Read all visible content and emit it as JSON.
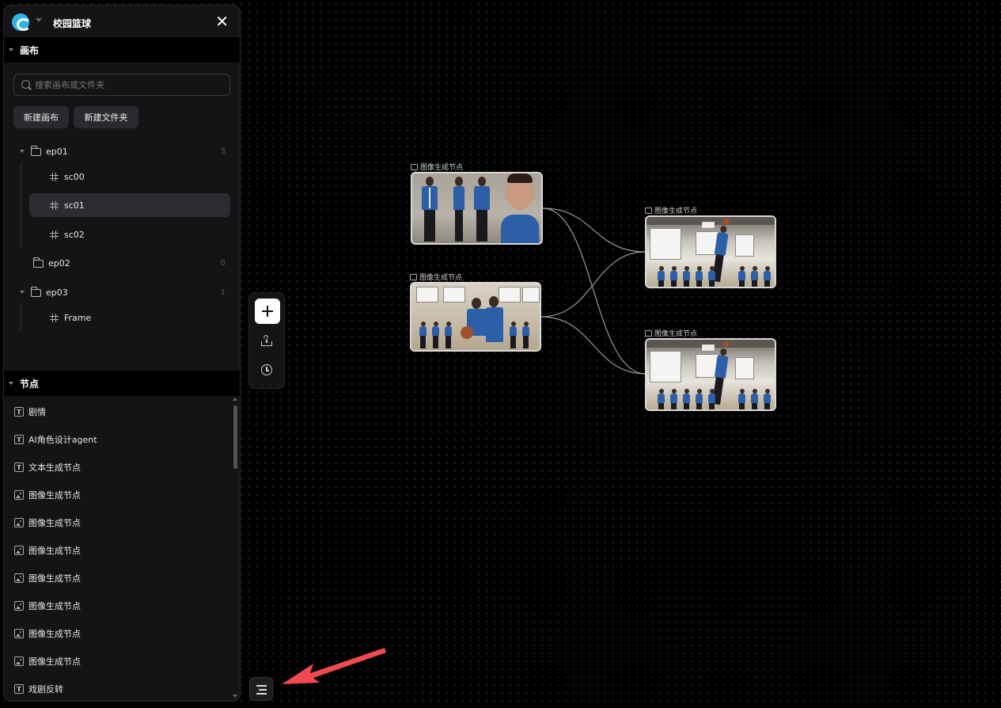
{
  "header": {
    "project_title": "校园篮球",
    "close_symbol": "✕"
  },
  "canvas_section": {
    "title": "画布"
  },
  "search": {
    "placeholder": "搜索画布或文件夹"
  },
  "buttons": {
    "new_canvas": "新建画布",
    "new_folder": "新建文件夹"
  },
  "tree": {
    "ep01": {
      "label": "ep01",
      "count": "3",
      "children": [
        "sc00",
        "sc01",
        "sc02"
      ],
      "selected": "sc01"
    },
    "ep02": {
      "label": "ep02",
      "count": "0"
    },
    "ep03": {
      "label": "ep03",
      "count": "1",
      "children": [
        "Frame"
      ]
    }
  },
  "nodes_section": {
    "title": "节点",
    "items": [
      {
        "label": "剧情",
        "icon": "text-icon"
      },
      {
        "label": "AI角色设计agent",
        "icon": "text-icon"
      },
      {
        "label": "文本生成节点",
        "icon": "text-icon"
      },
      {
        "label": "图像生成节点",
        "icon": "image-icon"
      },
      {
        "label": "图像生成节点",
        "icon": "image-icon"
      },
      {
        "label": "图像生成节点",
        "icon": "image-icon"
      },
      {
        "label": "图像生成节点",
        "icon": "image-icon"
      },
      {
        "label": "图像生成节点",
        "icon": "image-icon"
      },
      {
        "label": "图像生成节点",
        "icon": "image-icon"
      },
      {
        "label": "图像生成节点",
        "icon": "image-icon"
      },
      {
        "label": "戏剧反转",
        "icon": "text-icon"
      }
    ]
  },
  "toolbar": {
    "add": "add-icon",
    "upload": "upload-icon",
    "history": "history-icon"
  },
  "canvas_nodes": [
    {
      "label": "图像生成节点",
      "image": "character-sheet"
    },
    {
      "label": "图像生成节点",
      "image": "gym-group"
    },
    {
      "label": "图像生成节点",
      "image": "gym-dunk"
    },
    {
      "label": "图像生成节点",
      "image": "gym-dunk"
    }
  ],
  "colors": {
    "accent": "#2bb6e6",
    "annotation_arrow": "#ef4a4f",
    "jacket": "#2d5fa8"
  }
}
